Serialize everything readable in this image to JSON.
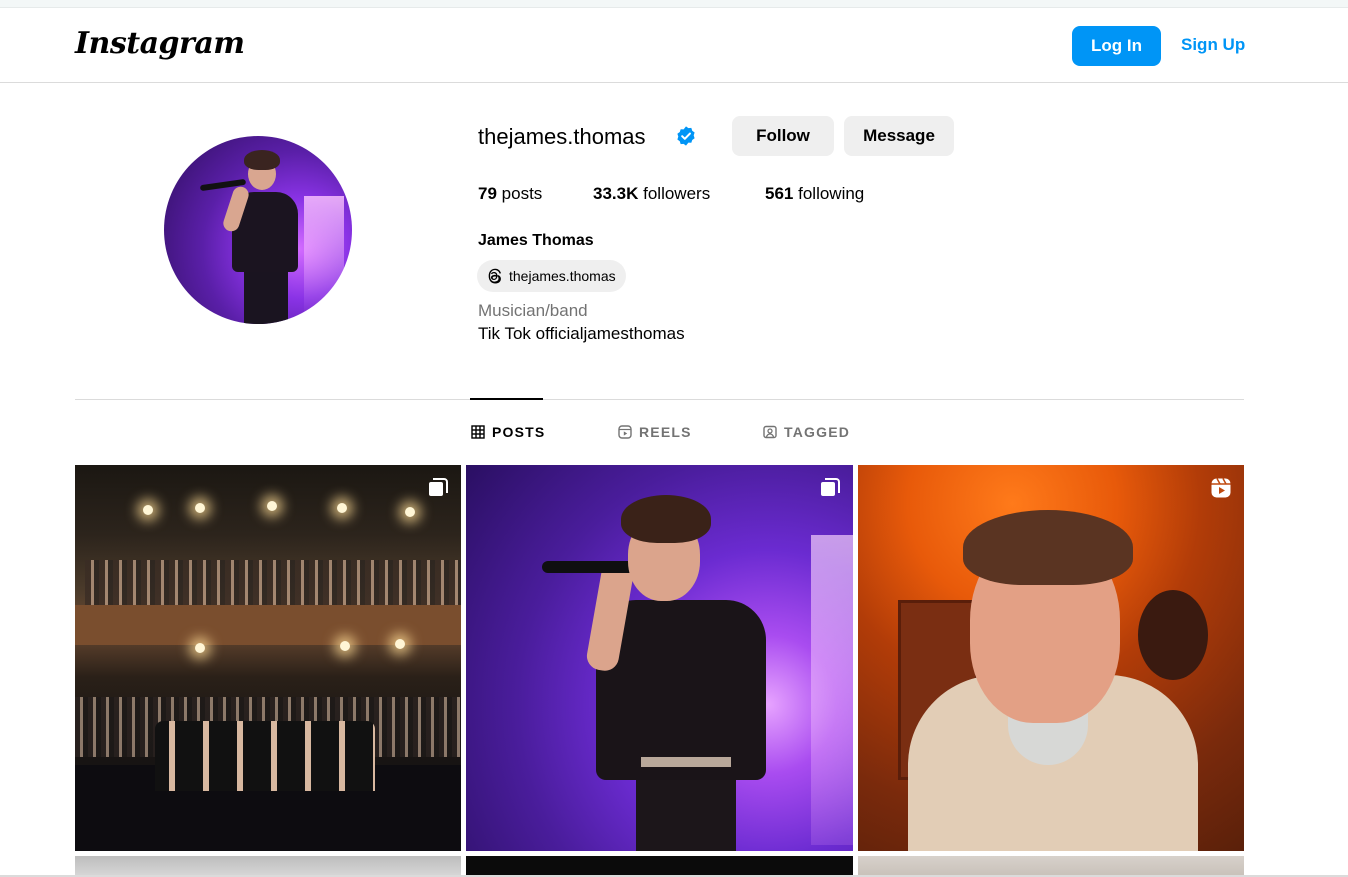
{
  "header": {
    "logo": "Instagram",
    "login_label": "Log In",
    "signup_label": "Sign Up",
    "accent_color": "#0095f6"
  },
  "profile": {
    "username": "thejames.thomas",
    "verified_icon": "verified-badge-icon",
    "follow_label": "Follow",
    "message_label": "Message",
    "stats": {
      "posts_count": "79",
      "posts_label": "posts",
      "followers_count": "33.3K",
      "followers_label": "followers",
      "following_count": "561",
      "following_label": "following"
    },
    "full_name": "James Thomas",
    "threads_handle": "thejames.thomas",
    "category": "Musician/band",
    "bio": "Tik Tok officialjamesthomas"
  },
  "tabs": [
    {
      "label": "POSTS",
      "icon": "grid-icon",
      "active": true
    },
    {
      "label": "REELS",
      "icon": "reels-icon",
      "active": false
    },
    {
      "label": "TAGGED",
      "icon": "tagged-icon",
      "active": false
    }
  ],
  "posts": [
    {
      "type": "carousel",
      "badge_icon": "carousel-icon",
      "subject": "concert hall crowd"
    },
    {
      "type": "carousel",
      "badge_icon": "carousel-icon",
      "subject": "singer on purple stage"
    },
    {
      "type": "reel",
      "badge_icon": "reels-icon",
      "subject": "selfie in orange room"
    }
  ]
}
